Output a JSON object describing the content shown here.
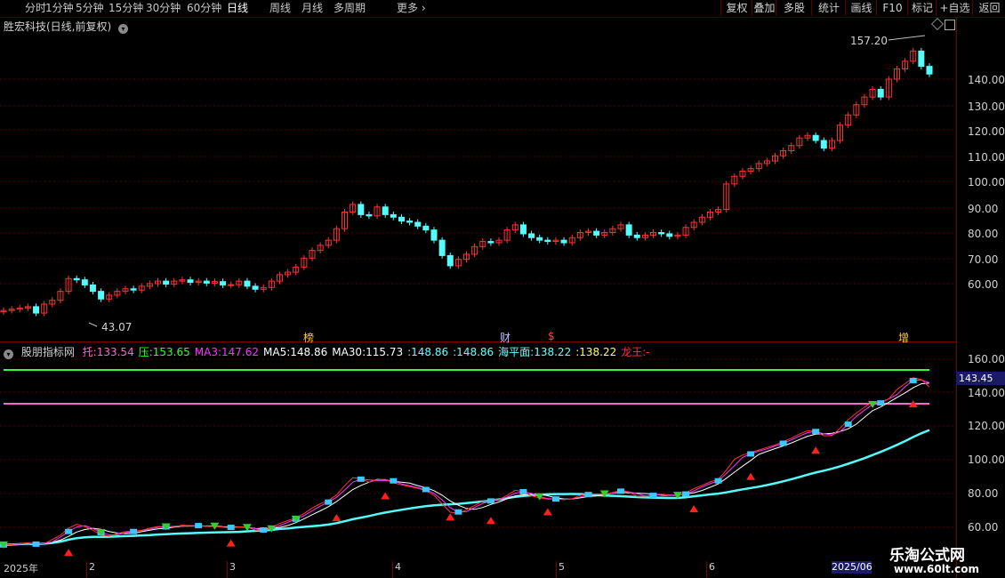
{
  "toolbar": {
    "left": [
      "分时",
      "1分钟",
      "5分钟",
      "15分钟",
      "30分钟",
      "60分钟",
      "日线",
      "周线",
      "月线",
      "多周期",
      "更多"
    ],
    "active": "日线",
    "right": [
      "复权",
      "叠加",
      "多股",
      "统计",
      "画线",
      "F10",
      "标记",
      "+自选",
      "返回"
    ]
  },
  "chart": {
    "title": "胜宏科技(日线,前复权)",
    "high_label": "157.20",
    "low_label": "43.07",
    "price_ticks": [
      "140.00",
      "130.00",
      "120.00",
      "110.00",
      "100.00",
      "90.00",
      "80.00",
      "70.00",
      "60.00"
    ],
    "markers": [
      "榜",
      "财",
      "$",
      "增"
    ]
  },
  "indicator": {
    "name": "股朋指标网",
    "items": [
      {
        "label": "托:",
        "value": "133.54",
        "color": "#ff66cc"
      },
      {
        "label": "压:",
        "value": "153.65",
        "color": "#33ff33"
      },
      {
        "label": "MA3:",
        "value": "147.62",
        "color": "#ff33ff"
      },
      {
        "label": "MA5:",
        "value": "148.86",
        "color": "#ffffff"
      },
      {
        "label": "MA30:",
        "value": "115.73",
        "color": "#ffffff"
      },
      {
        "label": ":",
        "value": "148.86",
        "color": "#66ffff"
      },
      {
        "label": ":",
        "value": "148.86",
        "color": "#66ffff"
      },
      {
        "label": "海平面:",
        "value": "138.22",
        "color": "#66ffff"
      },
      {
        "label": ":",
        "value": "138.22",
        "color": "#ffff66"
      },
      {
        "label": "龙王:",
        "value": "-",
        "color": "#ff3333"
      }
    ],
    "ticks": [
      "160.00",
      "140.00",
      "120.00",
      "100.00",
      "80.00",
      "60.00"
    ],
    "current": "143.45"
  },
  "dates": [
    "2025年",
    "2",
    "3",
    "4",
    "5",
    "6",
    "2025/06"
  ],
  "watermark": {
    "line1": "乐淘公式网",
    "line2": "www.60lt.com"
  },
  "colors": {
    "up": "#ff3232",
    "down": "#54fcfc",
    "support": "#ff66cc",
    "resist": "#33ff33",
    "axis": "#7a0000"
  }
}
